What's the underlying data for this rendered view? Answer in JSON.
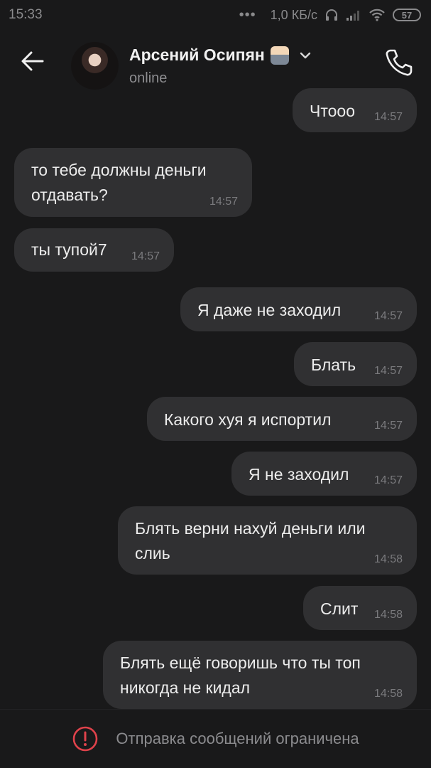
{
  "status_bar": {
    "time": "15:33",
    "dots": "•••",
    "network_speed": "1,0 КБ/с",
    "battery": "57"
  },
  "header": {
    "contact_name": "Арсений Осипян",
    "contact_status": "online"
  },
  "messages": [
    {
      "text": "Чтооо",
      "time": "14:57",
      "outgoing": true
    },
    {
      "text": "то тебе должны деньги\nотдавать?",
      "time": "14:57",
      "outgoing": false
    },
    {
      "text": "ты тупой7",
      "time": "14:57",
      "outgoing": false
    },
    {
      "text": "Я даже не заходил",
      "time": "14:57",
      "outgoing": true
    },
    {
      "text": "Блать",
      "time": "14:57",
      "outgoing": true
    },
    {
      "text": "Какого хуя я испортил",
      "time": "14:57",
      "outgoing": true
    },
    {
      "text": "Я не заходил",
      "time": "14:57",
      "outgoing": true
    },
    {
      "text": "Блять верни нахуй деньги или\nслиь",
      "time": "14:58",
      "outgoing": true
    },
    {
      "text": "Слит",
      "time": "14:58",
      "outgoing": true
    },
    {
      "text": "Блять ещё говоришь что ты топ\nникогда не кидал",
      "time": "14:58",
      "outgoing": true
    }
  ],
  "footer": {
    "restriction_text": "Отправка сообщений ограничена"
  },
  "colors": {
    "background": "#19191a",
    "bubble": "#303032",
    "alert_red": "#e0424b"
  }
}
